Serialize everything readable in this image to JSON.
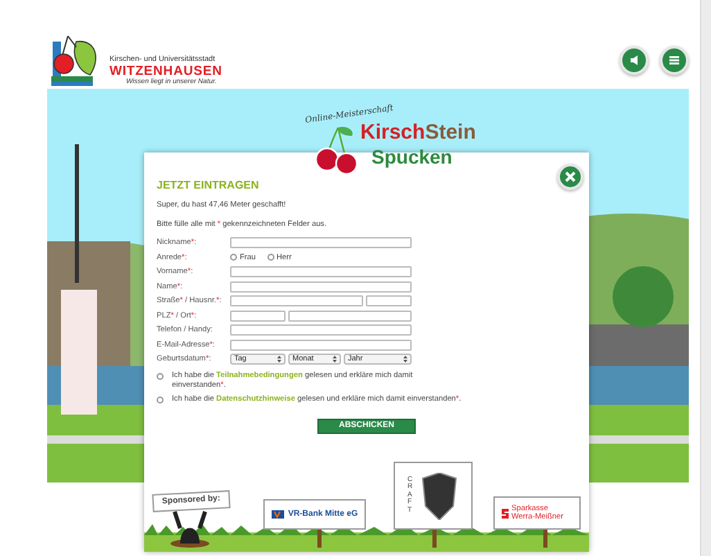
{
  "header": {
    "tagline_top": "Kirschen- und Universitätsstadt",
    "city": "WITZENHAUSEN",
    "slogan": "Wissen liegt in unserer Natur.",
    "buttons": [
      {
        "kind": "sound"
      },
      {
        "kind": "menu"
      }
    ]
  },
  "game_logo": {
    "subtitle": "Online-Meisterschaft",
    "word_1": "Kirsch",
    "word_2": "Stein",
    "word_3": "Spucken"
  },
  "dialog": {
    "title": "JETZT EINTRAGEN",
    "message": "Super, du hast 47,46 Meter geschafft!",
    "hint": [
      {
        "kind": "plain",
        "text": "Bitte fülle alle mit "
      },
      {
        "kind": "mark",
        "text": "*"
      },
      {
        "kind": "plain",
        "text": " gekennzeichneten Felder aus."
      }
    ],
    "fields": [
      {
        "kind": "text",
        "label": [
          {
            "kind": "plain",
            "text": "Nickname"
          },
          {
            "kind": "mark",
            "text": "*"
          },
          {
            "kind": "plain",
            "text": ":"
          }
        ]
      },
      {
        "kind": "radio",
        "label": [
          {
            "kind": "plain",
            "text": "Anrede"
          },
          {
            "kind": "mark",
            "text": "*"
          },
          {
            "kind": "plain",
            "text": ":"
          }
        ],
        "options": [
          {
            "label": "Frau",
            "selected": false
          },
          {
            "label": "Herr",
            "selected": false
          }
        ]
      },
      {
        "kind": "text",
        "label": [
          {
            "kind": "plain",
            "text": "Vorname"
          },
          {
            "kind": "mark",
            "text": "*"
          },
          {
            "kind": "plain",
            "text": ":"
          }
        ]
      },
      {
        "kind": "text",
        "label": [
          {
            "kind": "plain",
            "text": "Name"
          },
          {
            "kind": "mark",
            "text": "*"
          },
          {
            "kind": "plain",
            "text": ":"
          }
        ]
      },
      {
        "kind": "street",
        "label": [
          {
            "kind": "plain",
            "text": "Straße"
          },
          {
            "kind": "mark",
            "text": "*"
          },
          {
            "kind": "plain",
            "text": " / Hausnr."
          },
          {
            "kind": "mark",
            "text": "*"
          },
          {
            "kind": "plain",
            "text": ":"
          }
        ]
      },
      {
        "kind": "zip",
        "label": [
          {
            "kind": "plain",
            "text": "PLZ"
          },
          {
            "kind": "mark",
            "text": "*"
          },
          {
            "kind": "plain",
            "text": " / Ort"
          },
          {
            "kind": "mark",
            "text": "*"
          },
          {
            "kind": "plain",
            "text": ":"
          }
        ]
      },
      {
        "kind": "text",
        "label": [
          {
            "kind": "plain",
            "text": "Telefon / Handy:"
          }
        ]
      },
      {
        "kind": "text",
        "label": [
          {
            "kind": "plain",
            "text": "E-Mail-Adresse"
          },
          {
            "kind": "mark",
            "text": "*"
          },
          {
            "kind": "plain",
            "text": ":"
          }
        ]
      },
      {
        "kind": "select",
        "label": [
          {
            "kind": "plain",
            "text": "Geburtsdatum"
          },
          {
            "kind": "mark",
            "text": "*"
          },
          {
            "kind": "plain",
            "text": ":"
          }
        ],
        "selects": [
          {
            "value": "Tag"
          },
          {
            "value": "Monat"
          },
          {
            "value": "Jahr"
          }
        ]
      }
    ],
    "consents": [
      {
        "checked": false,
        "parts": [
          {
            "kind": "plain",
            "text": "Ich habe die "
          },
          {
            "kind": "link",
            "text": "Teilnahmebedingungen"
          },
          {
            "kind": "plain",
            "text": " gelesen und erkläre mich damit einverstanden"
          },
          {
            "kind": "mark",
            "text": "*"
          },
          {
            "kind": "plain",
            "text": "."
          }
        ]
      },
      {
        "checked": false,
        "parts": [
          {
            "kind": "plain",
            "text": "Ich habe die "
          },
          {
            "kind": "link",
            "text": "Datenschutzhinweise"
          },
          {
            "kind": "plain",
            "text": " gelesen und erkläre mich damit einverstanden"
          },
          {
            "kind": "mark",
            "text": "*"
          },
          {
            "kind": "plain",
            "text": "."
          }
        ]
      }
    ],
    "submit": "ABSCHICKEN",
    "sponsors": [
      {
        "kind": "intro",
        "text": "Sponsored by:"
      },
      {
        "kind": "bank",
        "text": "VR-Bank Mitte eG"
      },
      {
        "kind": "craft",
        "text": "CRAFT"
      },
      {
        "kind": "savings",
        "text": "Sparkasse Werra-Meißner"
      }
    ]
  }
}
